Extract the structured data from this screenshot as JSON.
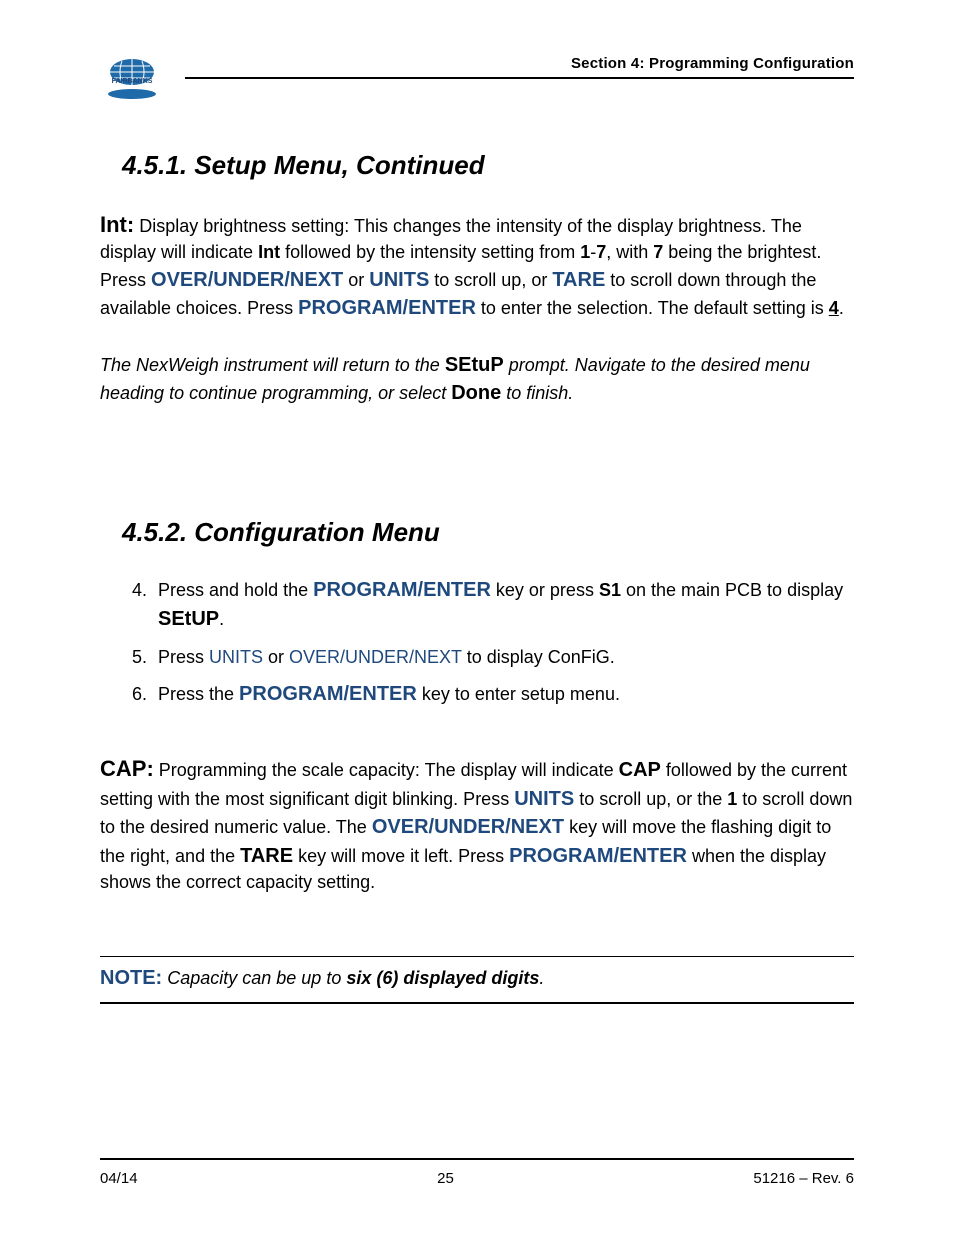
{
  "header": {
    "section_title": "Section 4: Programming Configuration",
    "logo_text": "FAIRBANKS"
  },
  "sec451": {
    "heading": "4.5.1. Setup Menu, Continued",
    "int_label": "Int:",
    "int_text_1": "  Display brightness setting:  This changes the intensity of the display brightness.  The display will indicate ",
    "int_bold_int": "Int",
    "int_text_2": " followed by the intensity setting from ",
    "int_bold_1": "1",
    "int_dash": "-",
    "int_bold_7a": "7",
    "int_text_3": ", with ",
    "int_bold_7b": "7",
    "int_text_4": " being the brightest.  Press ",
    "int_cmd_overunder": "OVER/UNDER/NEXT",
    "int_text_5": " or ",
    "int_cmd_units": "UNITS",
    "int_text_6": " to scroll up, or ",
    "int_cmd_tare": "TARE",
    "int_text_7": " to scroll down through the available choices.  Press ",
    "int_cmd_program": "PROGRAM/ENTER",
    "int_text_8": " to enter the selection.  The default setting is ",
    "int_default_4": "4",
    "int_text_9": ".",
    "return_text_1": "The NexWeigh instrument will return to the ",
    "return_setup": "SEtuP",
    "return_text_2": " prompt.  Navigate to the desired menu heading to continue programming, or select ",
    "return_done": "Done",
    "return_text_3": " to finish."
  },
  "sec452": {
    "heading": "4.5.2.  Configuration Menu",
    "steps": [
      {
        "t1": "Press and hold the ",
        "cmd1": "PROGRAM/ENTER",
        "t2": " key or press ",
        "cmd2": "S1",
        "t3": " on the main PCB to display ",
        "cmd3": "SEtUP",
        "t4": "."
      },
      {
        "t1": "Press ",
        "cmd1": "UNITS",
        "t2": " or ",
        "cmd2": "OVER/UNDER/NEXT",
        "t3": " to display ConFiG."
      },
      {
        "t1": "Press the ",
        "cmd1": "PROGRAM/ENTER",
        "t2": " key to enter setup menu."
      }
    ],
    "cap_label": "CAP:",
    "cap_t1": "  Programming the scale capacity:  The display will indicate ",
    "cap_cap": "CAP",
    "cap_t2": " followed by the current setting with the most significant digit blinking.  Press ",
    "cap_units": "UNITS",
    "cap_t3": " to scroll up, or the ",
    "cap_one": "1",
    "cap_t4": " to scroll down to the desired numeric value.  The ",
    "cap_overunder": "OVER/UNDER/NEXT",
    "cap_t5": " key will move the flashing digit to the right, and the ",
    "cap_tare": "TARE",
    "cap_t6": " key will move it left.  Press ",
    "cap_program": "PROGRAM/ENTER",
    "cap_t7": " when the display shows the correct capacity setting.",
    "note_label": "NOTE:",
    "note_t1": "   Capacity can be up to ",
    "note_bold": "six (6) displayed digits",
    "note_t2": "."
  },
  "footer": {
    "date": "04/14",
    "page": "25",
    "rev": "51216 – Rev. 6"
  }
}
